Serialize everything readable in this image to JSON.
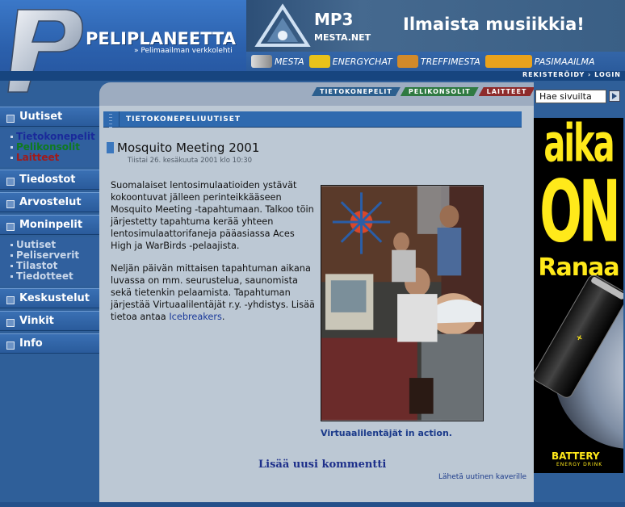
{
  "site": {
    "logo_title": "PELIPLANEETTA",
    "logo_subtitle": "» Pelimaailman verkkolehti"
  },
  "banner": {
    "brand": "MP3",
    "domain": "MESTA.NET",
    "slogan": "Ilmaista musiikkia!"
  },
  "partners": [
    "MESTA",
    "ENERGYCHAT",
    "TREFFIMESTA",
    "PASIMAAILMA"
  ],
  "toplinks": "REKISTERÖIDY › LOGIN",
  "tabs": [
    {
      "label": "TIETOKONEPELIT",
      "color": "#2c5f8e"
    },
    {
      "label": "PELIKONSOLIT",
      "color": "#2f7a42"
    },
    {
      "label": "LAITTEET",
      "color": "#8e2b2b"
    }
  ],
  "nav": {
    "uutiset": "Uutiset",
    "uutiset_sub": [
      "Tietokonepelit",
      "Pelikonsolit",
      "Laitteet"
    ],
    "tiedostot": "Tiedostot",
    "arvostelut": "Arvostelut",
    "moninpelit": "Moninpelit",
    "moninpelit_sub": [
      "Uutiset",
      "Peliserverit",
      "Tilastot",
      "Tiedotteet"
    ],
    "keskustelut": "Keskustelut",
    "vinkit": "Vinkit",
    "info": "Info"
  },
  "section": {
    "title": "TIETOKONEPELIUUTISET"
  },
  "article": {
    "title": "Mosquito Meeting 2001",
    "date": "Tiistai 26. kesäkuuta 2001 klo 10:30",
    "paragraph1": "Suomalaiset lentosimulaatioiden ystävät kokoontuvat jälleen perinteikkääseen Mosquito Meeting -tapahtumaan. Talkoo töin järjestetty tapahtuma kerää yhteen lentosimulaattorifaneja pääasiassa Aces High ja WarBirds -pelaajista.",
    "paragraph2_text": "Neljän päivän mittaisen tapahtuman aikana luvassa on mm. seurustelua, saunomista sekä tietenkin pelaamista. Tapahtuman järjestää Virtuaalilentäjät r.y. -yhdistys. Lisää tietoa antaa",
    "paragraph2_link": "Icebreakers",
    "paragraph2_end": ".",
    "photo_caption": "Virtuaalilentäjät in action."
  },
  "actions": {
    "add_comment": "Lisää uusi kommentti",
    "send_news": "Lähetä uutinen kaverille"
  },
  "search": {
    "placeholder": "Hae sivuilta"
  },
  "ad": {
    "line1": "aika",
    "line2": "ON",
    "line3": "Ranaa",
    "brand": "BATTERY",
    "brand_sub": "ENERGY DRINK",
    "can_brand": "BATTERY"
  },
  "colors": {
    "header_blue": "#2a5ea5",
    "nav_blue": "#2f5f99",
    "content_bg": "#bcc8d4",
    "ad_yellow": "#ffe91a"
  }
}
